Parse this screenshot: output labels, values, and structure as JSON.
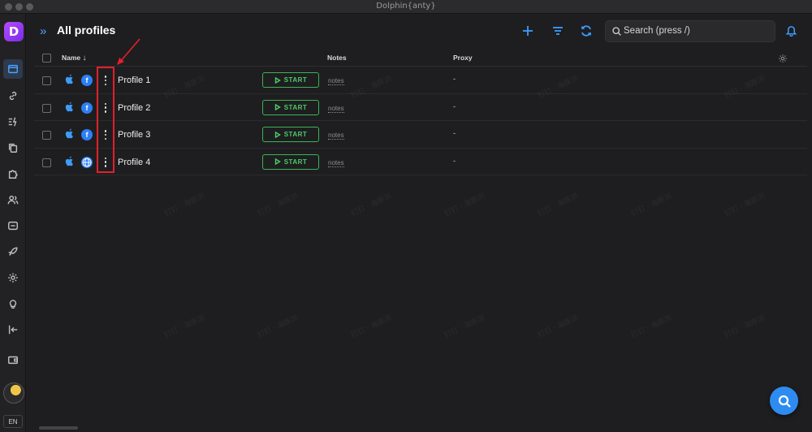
{
  "window": {
    "title": "Dolphin{anty}"
  },
  "sidebar": {
    "logo_letter": "D",
    "items": [
      {
        "name": "browser-profiles",
        "icon": "browser-window-icon",
        "active": true
      },
      {
        "name": "proxies",
        "icon": "link-icon"
      },
      {
        "name": "automation",
        "icon": "lightning-list-icon"
      },
      {
        "name": "copy",
        "icon": "copy-icon"
      },
      {
        "name": "extensions",
        "icon": "puzzle-icon"
      },
      {
        "name": "users",
        "icon": "users-icon"
      },
      {
        "name": "api",
        "icon": "api-icon"
      },
      {
        "name": "launch",
        "icon": "rocket-icon"
      },
      {
        "name": "settings",
        "icon": "gear-icon"
      },
      {
        "name": "tips",
        "icon": "lightbulb-icon"
      },
      {
        "name": "logout",
        "icon": "logout-icon"
      },
      {
        "name": "wallet",
        "icon": "wallet-icon"
      }
    ],
    "lang": "EN"
  },
  "header": {
    "title": "All profiles",
    "search_placeholder": "Search (press /)"
  },
  "table": {
    "columns": {
      "name": "Name",
      "notes": "Notes",
      "proxy": "Proxy"
    },
    "rows": [
      {
        "name": "Profile 1",
        "os": "apple-icon",
        "browser": "facebook-icon",
        "browser_letter": "f",
        "action": "START",
        "notes": "notes",
        "proxy": "-"
      },
      {
        "name": "Profile 2",
        "os": "apple-icon",
        "browser": "facebook-icon",
        "browser_letter": "f",
        "action": "START",
        "notes": "notes",
        "proxy": "-"
      },
      {
        "name": "Profile 3",
        "os": "apple-icon",
        "browser": "facebook-icon",
        "browser_letter": "f",
        "action": "START",
        "notes": "notes",
        "proxy": "-"
      },
      {
        "name": "Profile 4",
        "os": "apple-icon",
        "browser": "globe-icon",
        "browser_letter": "",
        "action": "START",
        "notes": "notes",
        "proxy": "-"
      }
    ]
  },
  "watermark_text": "钉钉 · 海豚浏",
  "colors": {
    "accent": "#3b9cff",
    "start_green": "#4dcb68",
    "annotation_red": "#e3202a",
    "logo_purple": "#9b3cf5"
  }
}
